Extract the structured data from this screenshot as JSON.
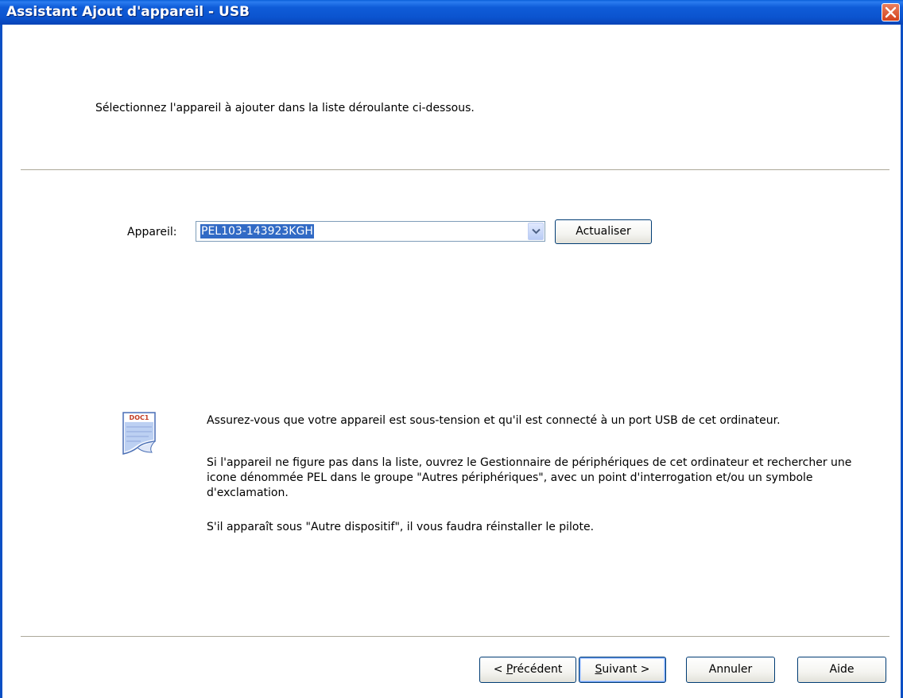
{
  "window": {
    "title": "Assistant Ajout d'appareil - USB"
  },
  "header": {
    "instruction": "Sélectionnez l'appareil à ajouter dans la liste déroulante ci-dessous."
  },
  "device": {
    "label": "Appareil:",
    "selected": "PEL103-143923KGH",
    "refresh_label": "Actualiser"
  },
  "info": {
    "icon": "doc-icon",
    "icon_text": "DOC1",
    "line1": "Assurez-vous que votre appareil est sous-tension et qu'il est connecté à un port USB de cet ordinateur.",
    "line2": "Si l'appareil ne figure pas dans la liste, ouvrez le Gestionnaire de périphériques de cet ordinateur et rechercher une icone dénommée PEL dans le groupe \"Autres périphériques\", avec un point d'interrogation et/ou un symbole d'exclamation.",
    "line3": "S'il apparaît sous \"Autre dispositif\", il vous faudra réinstaller le pilote."
  },
  "footer": {
    "prev_prefix": "< ",
    "prev_mnemonic": "P",
    "prev_rest": "récédent",
    "next_mnemonic": "S",
    "next_rest": "uivant >",
    "cancel_label": "Annuler",
    "help_label": "Aide"
  },
  "colors": {
    "titlebar": "#0b54cf",
    "selection": "#316ac5",
    "close": "#d4421c"
  }
}
